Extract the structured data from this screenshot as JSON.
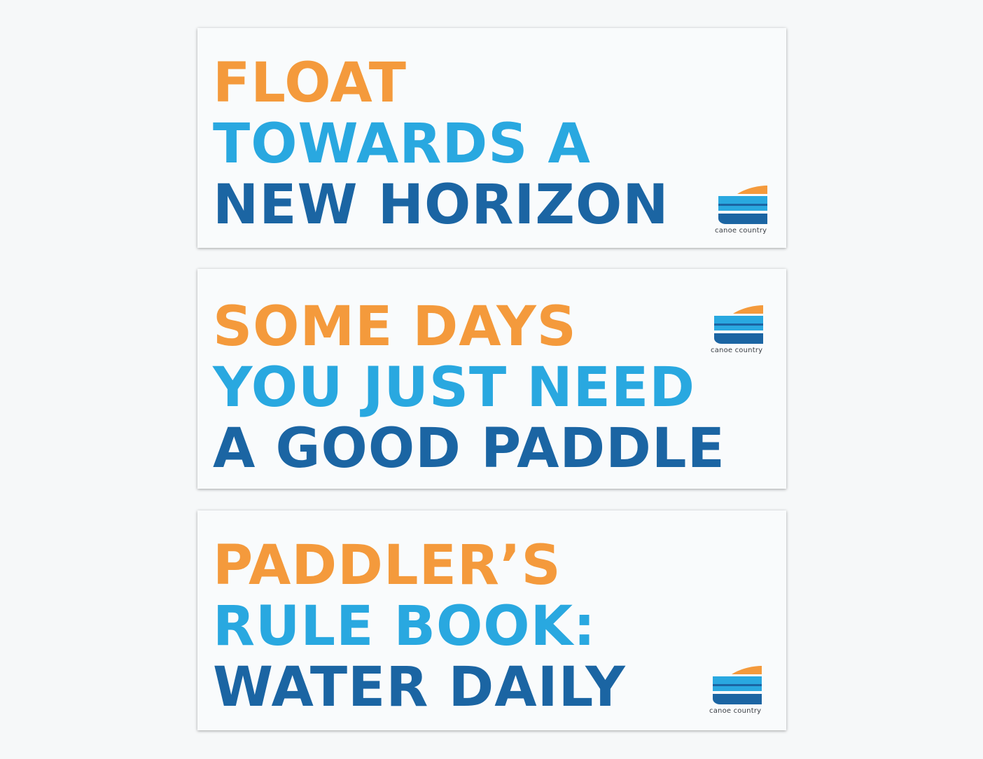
{
  "colors": {
    "orange": "#f49a3c",
    "light_blue": "#29a8e0",
    "dark_blue": "#1b65a3",
    "background": "#f6f8f9",
    "card": "#f9fbfc"
  },
  "banners": [
    {
      "lines": [
        "FLOAT",
        "TOWARDS A",
        "NEW HORIZON"
      ],
      "logo_text": "canoe country",
      "logo_icon": "canoe-logo-icon"
    },
    {
      "lines": [
        "SOME DAYS",
        "YOU JUST NEED",
        "A GOOD PADDLE"
      ],
      "logo_text": "canoe country",
      "logo_icon": "canoe-logo-icon"
    },
    {
      "lines": [
        "PADDLER’S",
        "RULE BOOK:",
        "WATER DAILY"
      ],
      "logo_text": "canoe country",
      "logo_icon": "canoe-logo-icon"
    }
  ]
}
